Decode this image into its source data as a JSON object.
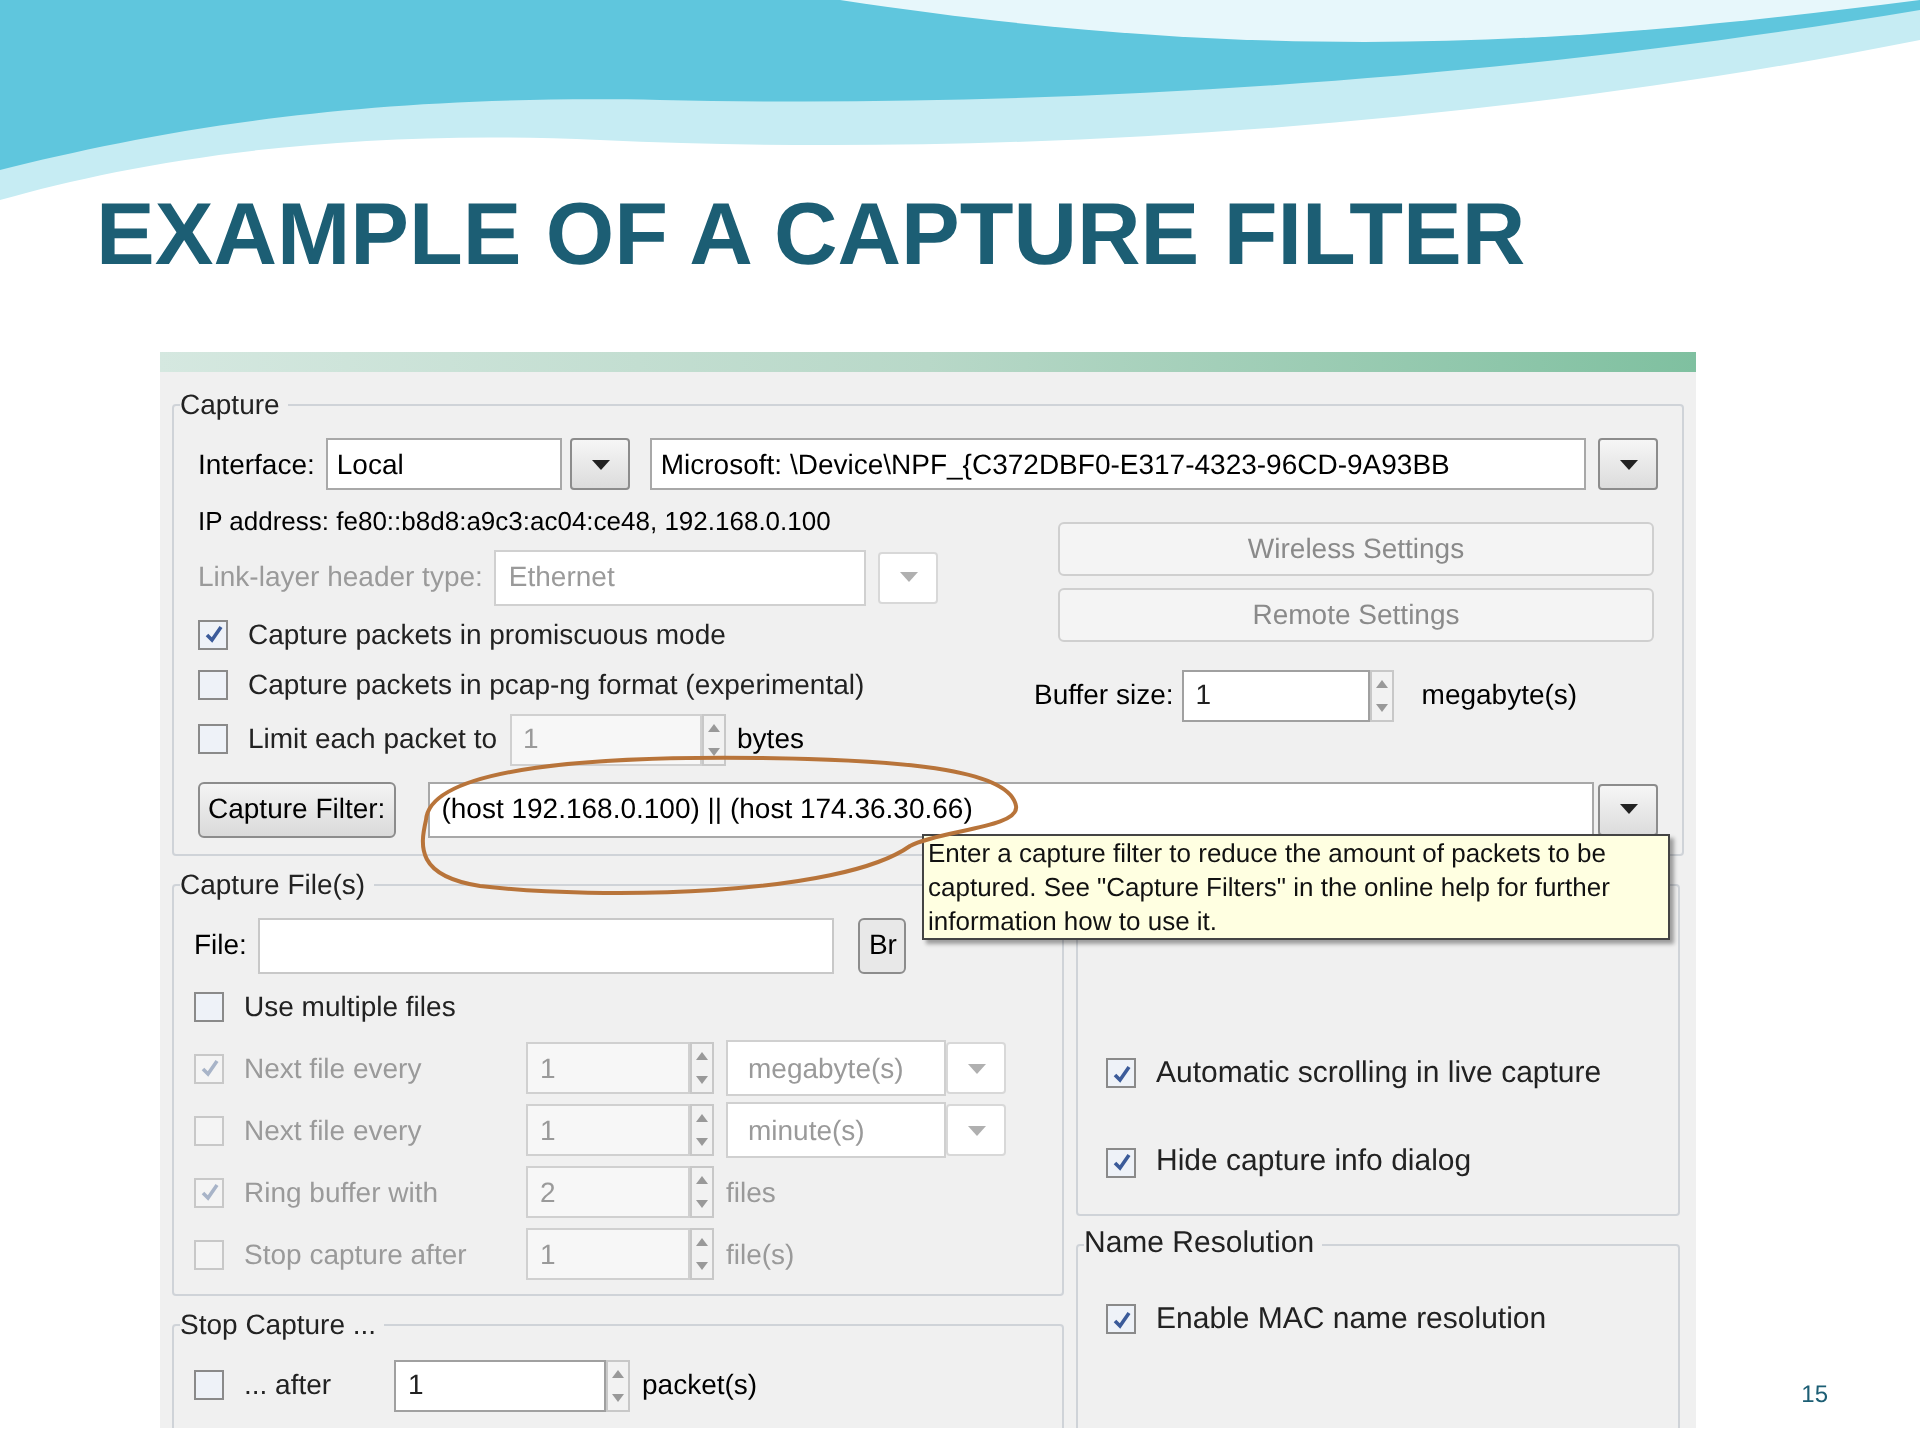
{
  "slide": {
    "title": "EXAMPLE OF A CAPTURE FILTER",
    "page_number": "15"
  },
  "capture": {
    "legend": "Capture",
    "interface_label": "Interface:",
    "interface_type": "Local",
    "interface_device": "Microsoft: \\Device\\NPF_{C372DBF0-E317-4323-96CD-9A93BB",
    "ip_address": "IP address: fe80::b8d8:a9c3:ac04:ce48, 192.168.0.100",
    "link_layer": {
      "label": "Link-layer header type:",
      "value": "Ethernet",
      "disabled": true
    },
    "options": [
      {
        "label": "Capture packets in promiscuous mode",
        "checked": true
      },
      {
        "label": "Capture packets in pcap-ng format (experimental)",
        "checked": false
      }
    ],
    "limit": {
      "label": "Limit each packet to",
      "checked": false,
      "value": "1",
      "unit": "bytes"
    },
    "buttons": [
      {
        "label": "Wireless Settings",
        "disabled": true
      },
      {
        "label": "Remote Settings",
        "disabled": true
      }
    ],
    "buffer": {
      "label": "Buffer size:",
      "value": "1",
      "unit": "megabyte(s)"
    },
    "filter": {
      "button": "Capture Filter:",
      "value": "(host 192.168.0.100) || (host 174.36.30.66)"
    }
  },
  "tooltip": "Enter a capture filter to reduce the amount of packets to be captured. See \"Capture Filters\" in the online help for further information how to use it.",
  "capture_files": {
    "legend": "Capture File(s)",
    "file_label": "File:",
    "browse": "Br",
    "multiple": {
      "label": "Use multiple files",
      "checked": false
    },
    "rows": [
      {
        "label": "Next file every",
        "checked": true,
        "disabled": true,
        "value": "1",
        "unit": "megabyte(s)",
        "kind": "combo"
      },
      {
        "label": "Next file every",
        "checked": false,
        "disabled": true,
        "value": "1",
        "unit": "minute(s)",
        "kind": "combo"
      },
      {
        "label": "Ring buffer with",
        "checked": true,
        "disabled": true,
        "value": "2",
        "unit": "files",
        "kind": "text"
      },
      {
        "label": "Stop capture after",
        "checked": false,
        "disabled": true,
        "value": "1",
        "unit": "file(s)",
        "kind": "text"
      }
    ]
  },
  "stop_capture": {
    "legend": "Stop Capture ...",
    "rows": [
      {
        "label": "... after",
        "checked": false,
        "disabled": false,
        "value": "1",
        "unit": "packet(s)"
      }
    ]
  },
  "display_options": [
    {
      "label": "Automatic scrolling in live capture",
      "checked": true
    },
    {
      "label": "Hide capture info dialog",
      "checked": true
    }
  ],
  "name_resolution": {
    "legend": "Name Resolution",
    "options": [
      {
        "label": "Enable MAC name resolution",
        "checked": true
      }
    ]
  }
}
